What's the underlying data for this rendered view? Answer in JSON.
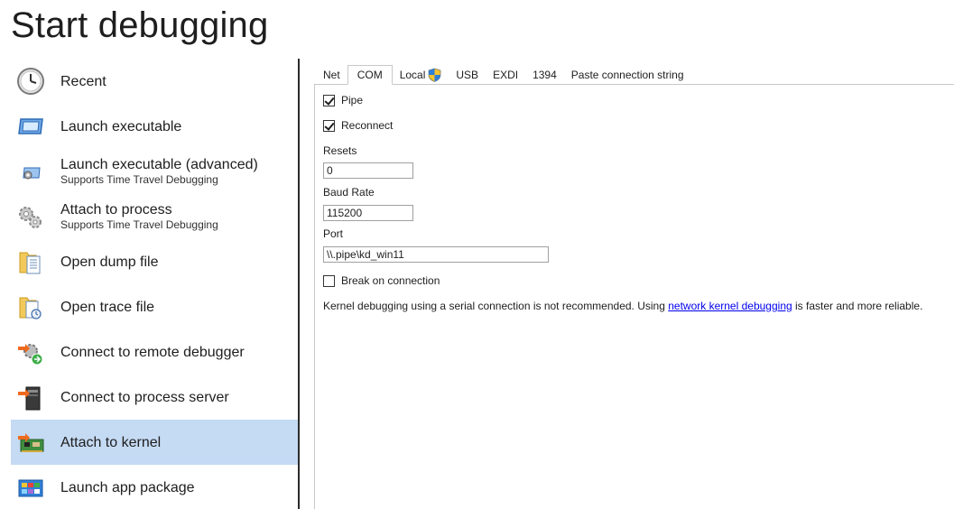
{
  "title": "Start debugging",
  "sidebar": {
    "items": [
      {
        "label": "Recent",
        "sub": ""
      },
      {
        "label": "Launch executable",
        "sub": ""
      },
      {
        "label": "Launch executable (advanced)",
        "sub": "Supports Time Travel Debugging"
      },
      {
        "label": "Attach to process",
        "sub": "Supports Time Travel Debugging"
      },
      {
        "label": "Open dump file",
        "sub": ""
      },
      {
        "label": "Open trace file",
        "sub": ""
      },
      {
        "label": "Connect to remote debugger",
        "sub": ""
      },
      {
        "label": "Connect to process server",
        "sub": ""
      },
      {
        "label": "Attach to kernel",
        "sub": ""
      },
      {
        "label": "Launch app package",
        "sub": ""
      }
    ],
    "selected": "Attach to kernel",
    "icons": [
      "clock-icon",
      "window-icon",
      "window-gear-icon",
      "gears-icon",
      "dump-file-icon",
      "trace-file-icon",
      "remote-debugger-icon",
      "process-server-icon",
      "kernel-board-icon",
      "app-package-icon"
    ]
  },
  "tabs": [
    "Net",
    "COM",
    "Local",
    "USB",
    "EXDI",
    "1394",
    "Paste connection string"
  ],
  "active_tab": "COM",
  "com": {
    "pipe_label": "Pipe",
    "pipe_checked": true,
    "reconnect_label": "Reconnect",
    "reconnect_checked": true,
    "resets_label": "Resets",
    "resets_value": "0",
    "baud_label": "Baud Rate",
    "baud_value": "115200",
    "port_label": "Port",
    "port_value": "\\\\.pipe\\kd_win11",
    "break_label": "Break on connection",
    "break_checked": false,
    "note_before": "Kernel debugging using a serial connection is not recommended. Using ",
    "note_link": "network kernel debugging",
    "note_after": " is faster and more reliable."
  },
  "colors": {
    "selected_bg": "#c5daf3",
    "link": "#0000ee",
    "splitter": "#2b2b2b"
  }
}
